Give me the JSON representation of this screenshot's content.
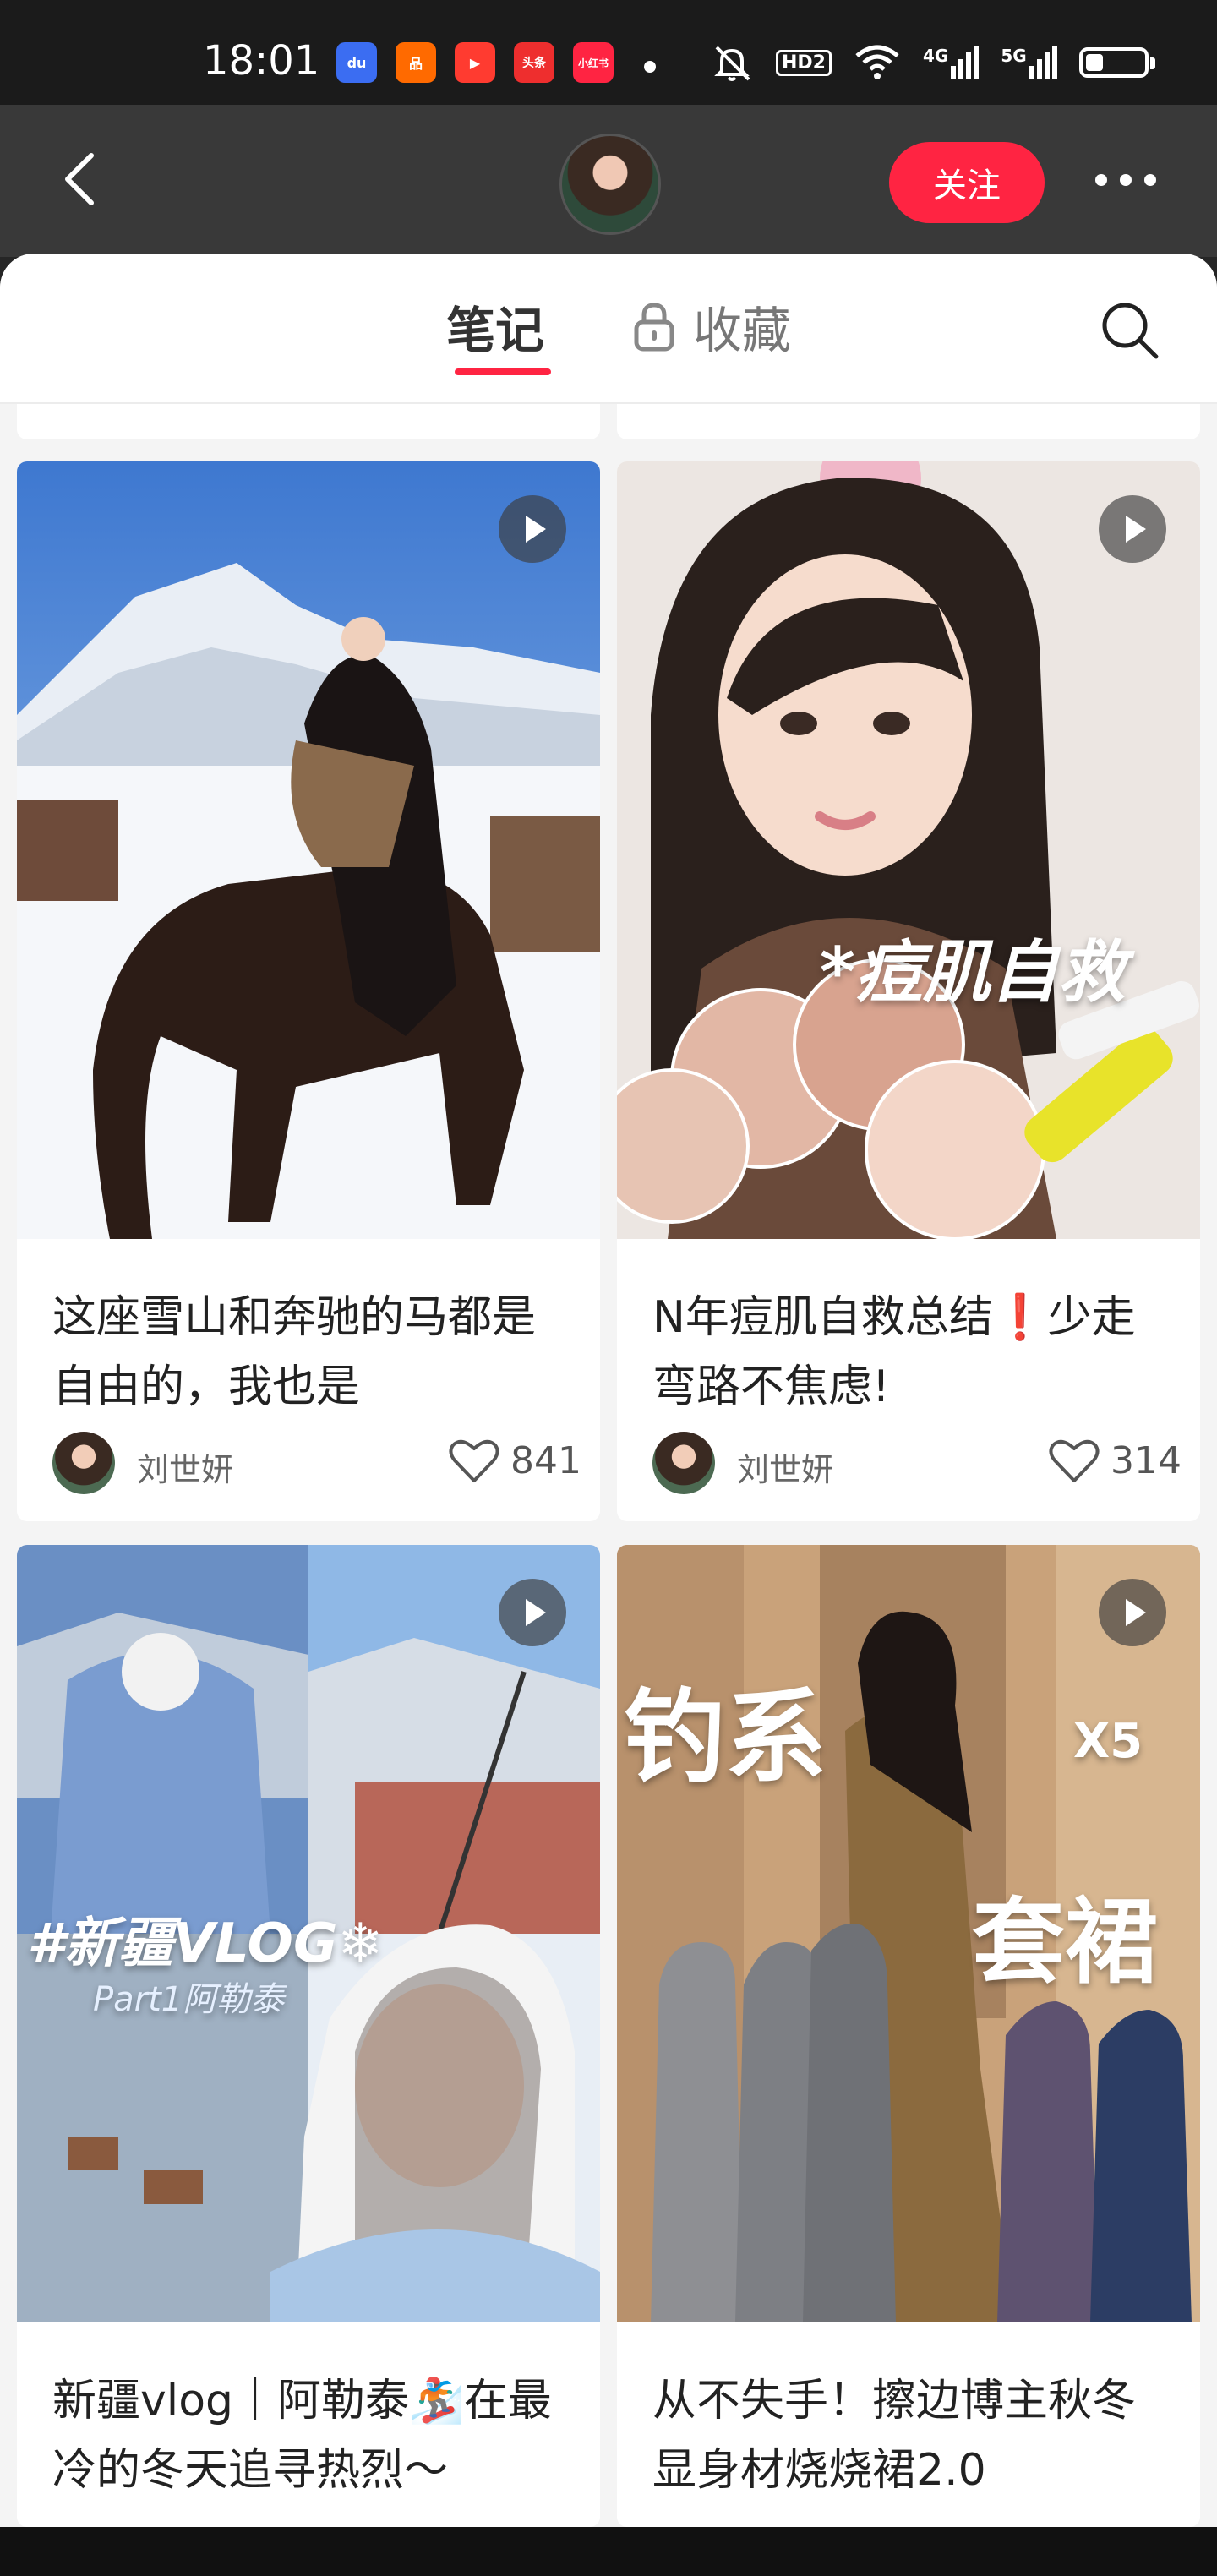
{
  "status_bar": {
    "time": "18:01",
    "apps": [
      {
        "name": "baidu-icon",
        "label": "du",
        "color": "#3b6df2"
      },
      {
        "name": "app-grid-icon",
        "label": "品",
        "color": "#ff6a00"
      },
      {
        "name": "video-icon",
        "label": "▶",
        "color": "#ff3b30"
      },
      {
        "name": "toutiao-icon",
        "label": "头条",
        "color": "#ee2e2e"
      },
      {
        "name": "xiaohongshu-icon",
        "label": "小红书",
        "color": "#ff2442"
      }
    ],
    "hd_label": "HD2",
    "net_4g": "4G",
    "net_5g": "5G"
  },
  "header": {
    "follow_label": "关注"
  },
  "tabs": {
    "notes": "笔记",
    "collect": "收藏"
  },
  "colors": {
    "accent": "#ff2442"
  },
  "notes": [
    {
      "title": "这座雪山和奔驰的马都是自由的，我也是",
      "author": "刘世妍",
      "likes": "841",
      "video": true
    },
    {
      "title": "N年痘肌自救总结❗少走弯路不焦虑!",
      "author": "刘世妍",
      "likes": "314",
      "video": true,
      "cover_text": "*痘肌自救"
    },
    {
      "title": "新疆vlog｜阿勒泰🏂在最冷的冬天追寻热烈～",
      "video": true,
      "cover_text": "#新疆VLOG❄",
      "cover_subtext": "Part1阿勒泰"
    },
    {
      "title": "从不失手！擦边博主秋冬显身材烧烧裙2.0",
      "video": true,
      "cover_text_1": "钓系",
      "cover_text_2": "套裙",
      "cover_text_3": "X5"
    }
  ]
}
